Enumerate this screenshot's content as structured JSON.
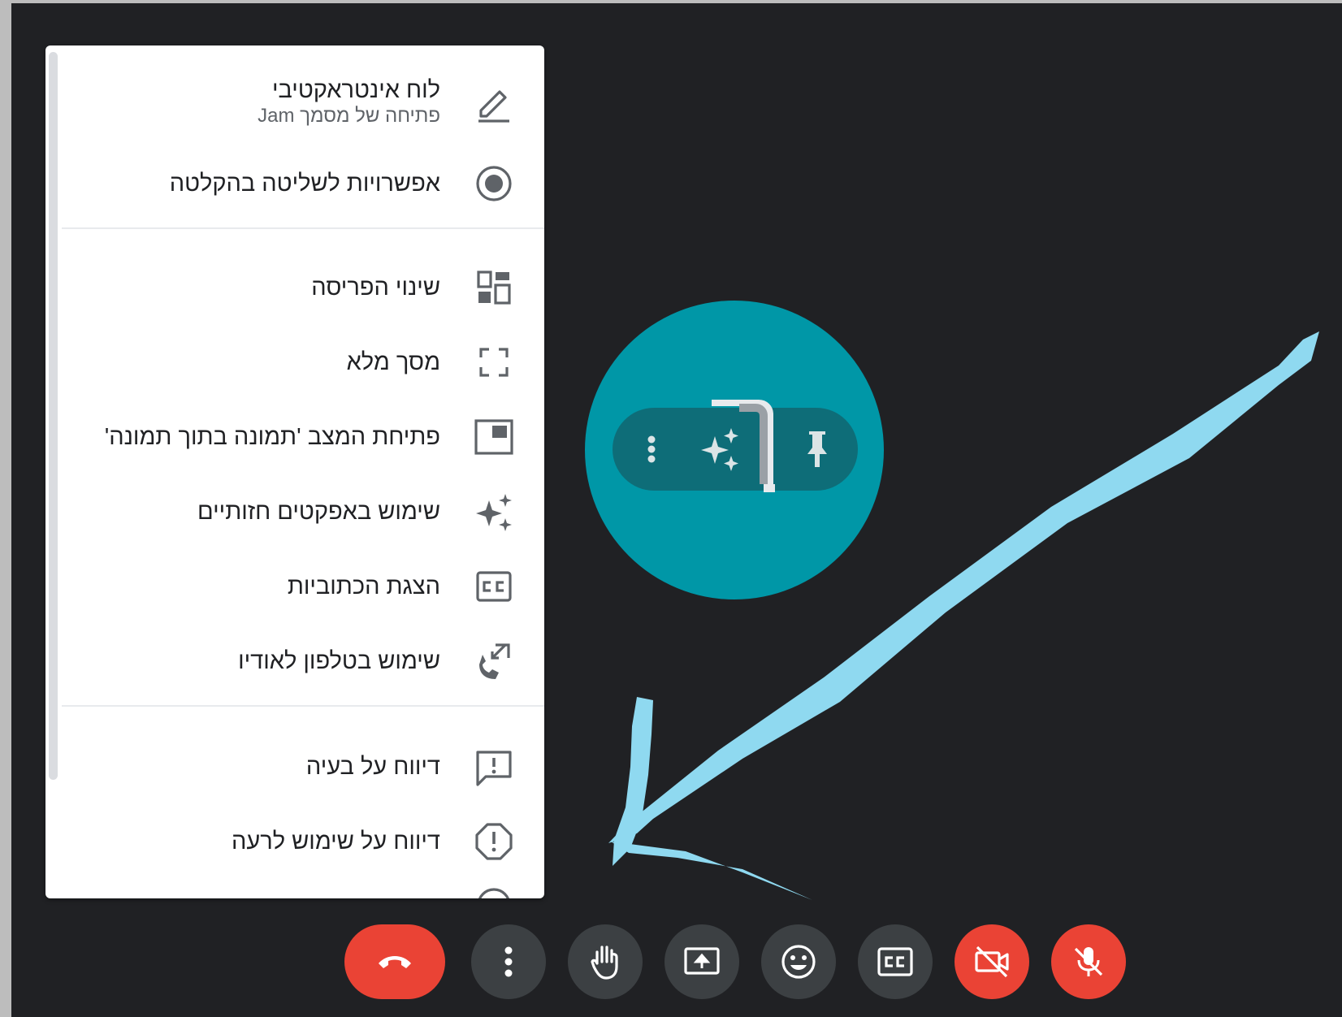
{
  "menu": {
    "items": [
      {
        "id": "whiteboard",
        "label": "לוח אינטראקטיבי",
        "sublabel": "פתיחה של מסמך Jam",
        "icon": "pencil-icon"
      },
      {
        "id": "recording",
        "label": "אפשרויות לשליטה בהקלטה",
        "icon": "record-icon"
      },
      {
        "id": "layout",
        "label": "שינוי הפריסה",
        "icon": "layout-icon"
      },
      {
        "id": "fullscreen",
        "label": "מסך מלא",
        "icon": "fullscreen-icon"
      },
      {
        "id": "pip",
        "label": "פתיחת המצב 'תמונה בתוך תמונה'",
        "icon": "picture-in-picture-icon"
      },
      {
        "id": "effects",
        "label": "שימוש באפקטים חזותיים",
        "icon": "sparkle-icon"
      },
      {
        "id": "captions",
        "label": "הצגת הכתוביות",
        "icon": "closed-captions-icon"
      },
      {
        "id": "phone-audio",
        "label": "שימוש בטלפון לאודיו",
        "icon": "phone-audio-icon"
      },
      {
        "id": "report-problem",
        "label": "דיווח על בעיה",
        "icon": "feedback-icon"
      },
      {
        "id": "report-abuse",
        "label": "דיווח על שימוש לרעה",
        "icon": "report-icon"
      }
    ]
  },
  "participant_tile": {
    "hover_bar": {
      "more_icon": "more-vert-icon",
      "effects_icon": "sparkle-icon",
      "pin_icon": "pin-icon"
    }
  },
  "controls": {
    "end_call_icon": "call-end-icon",
    "more_icon": "more-vert-icon",
    "raise_hand_icon": "hand-icon",
    "present_icon": "present-screen-icon",
    "reactions_icon": "emoji-icon",
    "captions_icon": "closed-captions-icon",
    "camera_off_icon": "camera-off-icon",
    "mic_off_icon": "mic-off-icon"
  },
  "colors": {
    "background": "#202124",
    "menu_bg": "#ffffff",
    "text": "#202124",
    "secondary_text": "#5f6368",
    "icon": "#5f6368",
    "avatar": "#0097a7",
    "control_bg": "#3c4043",
    "danger": "#ea4335",
    "annotation_arrow": "#8fd9f0"
  }
}
